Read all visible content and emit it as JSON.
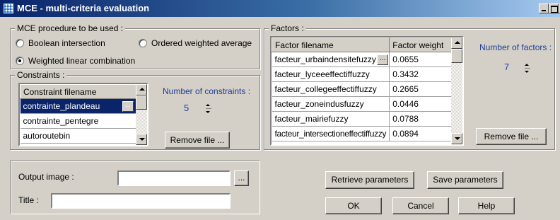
{
  "window": {
    "title": "MCE - multi-criteria evaluation"
  },
  "procedure": {
    "legend": "MCE procedure to be used :",
    "options": [
      {
        "label": "Boolean intersection",
        "selected": false
      },
      {
        "label": "Ordered weighted average",
        "selected": false
      },
      {
        "label": "Weighted linear combination",
        "selected": true
      }
    ]
  },
  "constraints": {
    "legend": "Constraints :",
    "column": "Constraint filename",
    "rows": [
      "contrainte_plandeau",
      "contrainte_pentegre",
      "autoroutebin"
    ],
    "count_label": "Number of constraints :",
    "count": "5",
    "remove_label": "Remove file ..."
  },
  "factors": {
    "legend": "Factors :",
    "columns": [
      "Factor filename",
      "Factor weight"
    ],
    "rows": [
      {
        "name": "facteur_urbaindensitefuzzy",
        "weight": "0.0655"
      },
      {
        "name": "facteur_lyceeeffectiffuzzy",
        "weight": "0.3432"
      },
      {
        "name": "facteur_collegeeffectiffuzzy",
        "weight": "0.2665"
      },
      {
        "name": "facteur_zoneindusfuzzy",
        "weight": "0.0446"
      },
      {
        "name": "facteur_mairiefuzzy",
        "weight": "0.0788"
      },
      {
        "name": "facteur_intersectioneffectiffuzzy",
        "weight": "0.0894"
      }
    ],
    "count_label": "Number of factors :",
    "count": "7",
    "remove_label": "Remove file ..."
  },
  "output": {
    "image_label": "Output image :",
    "image_value": "",
    "browse_label": "...",
    "title_label": "Title :",
    "title_value": ""
  },
  "buttons": {
    "retrieve": "Retrieve parameters",
    "save": "Save parameters",
    "ok": "OK",
    "cancel": "Cancel",
    "help": "Help"
  },
  "colors": {
    "titlebar_start": "#0a246a",
    "titlebar_end": "#a6caf0",
    "selection": "#0a246a",
    "accent_text": "#1c3c96"
  }
}
